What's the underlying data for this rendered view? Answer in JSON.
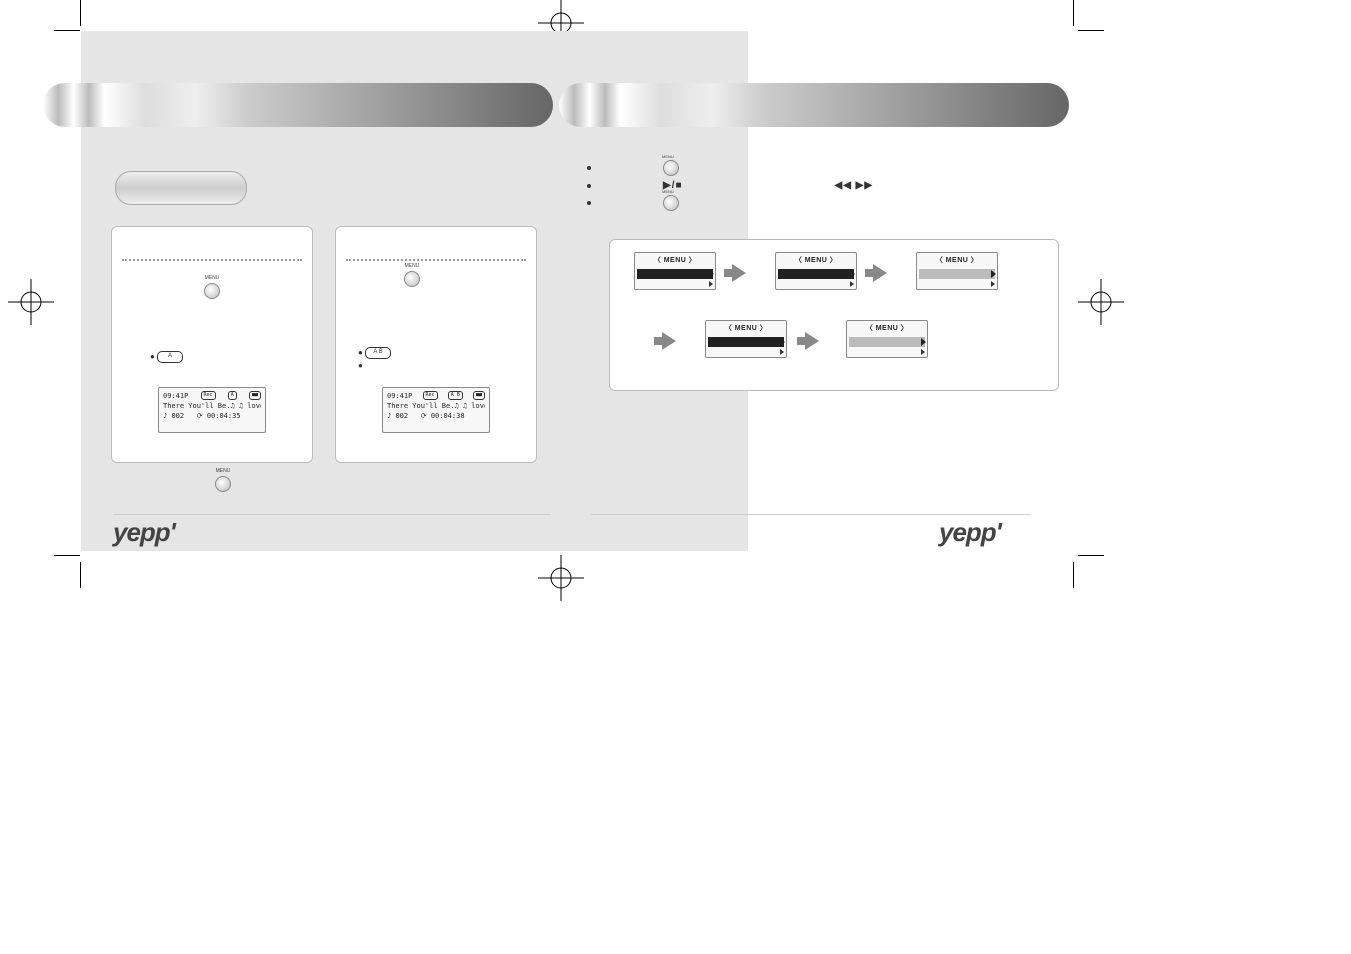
{
  "logo_text": "yepp'",
  "left_panel": {
    "lcd1": {
      "clock": "09:41P",
      "rec_badge": "Rec",
      "loop_badge": "A",
      "battery": "■■",
      "track_title": "There You'll Be.♫ ♫ love",
      "track_num": "002",
      "elapsed": "00:04:35"
    },
    "lcd2": {
      "clock": "09:41P",
      "rec_badge": "Rec",
      "loop_badge": "A B",
      "battery": "■■",
      "track_title": "There You'll Be.♫ ♫ love",
      "track_num": "002",
      "elapsed": "00:04:38"
    },
    "menu_label": "MENU",
    "ab_a": "A",
    "ab_ab": "A   B"
  },
  "right_panel": {
    "play_stop": "▶/■",
    "rew_fwd": "◀◀  ▶▶",
    "menu_label": "MENU",
    "menu_title": "〈 MENU 〉"
  }
}
